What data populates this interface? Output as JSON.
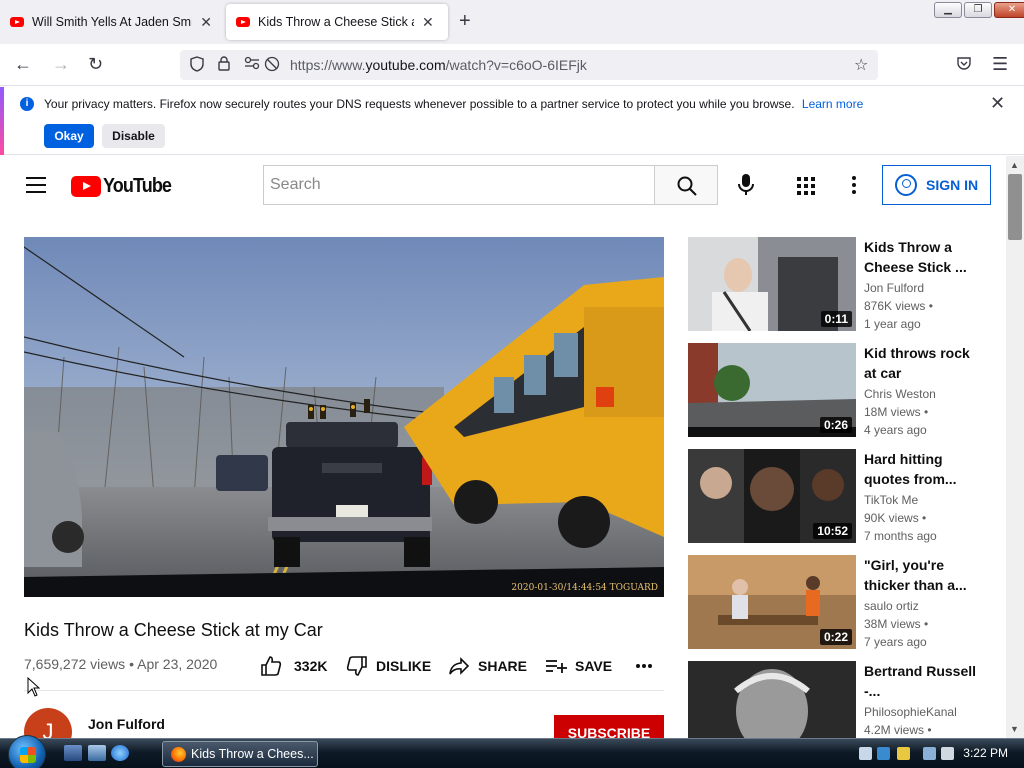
{
  "browser": {
    "tabs": [
      {
        "title": "Will Smith Yells At Jaden Smith",
        "active": false
      },
      {
        "title": "Kids Throw a Cheese Stick at my",
        "active": true
      }
    ],
    "url_prefix": "https://www.",
    "url_domain": "youtube.com",
    "url_path": "/watch?v=c6oO-6IEFjk"
  },
  "notification": {
    "message": "Your privacy matters. Firefox now securely routes your DNS requests whenever possible to a partner service to protect you while you browse.",
    "learn_more": "Learn more",
    "okay_label": "Okay",
    "disable_label": "Disable"
  },
  "youtube": {
    "logo_text": "YouTube",
    "search_placeholder": "Search",
    "sign_in_label": "SIGN IN"
  },
  "video": {
    "title": "Kids Throw a Cheese Stick at my Car",
    "views": "7,659,272 views",
    "date": "Apr 23, 2020",
    "meta_sep": "•",
    "likes": "332K",
    "dislike_label": "DISLIKE",
    "share_label": "SHARE",
    "save_label": "SAVE",
    "dashcam_timestamp": "2020-01-30/14:44:54 TOGUARD",
    "channel_name": "Jon Fulford",
    "channel_initial": "J",
    "subscribe_label": "SUBSCRIBE"
  },
  "recommendations": [
    {
      "title": "Kids Throw a Cheese Stick ...",
      "channel": "Jon Fulford",
      "views": "876K views •",
      "age": "1 year ago",
      "duration": "0:11"
    },
    {
      "title": "Kid throws rock at car",
      "channel": "Chris Weston",
      "views": "18M views •",
      "age": "4 years ago",
      "duration": "0:26"
    },
    {
      "title": "Hard hitting quotes from...",
      "channel": "TikTok Me",
      "views": "90K views •",
      "age": "7 months ago",
      "duration": "10:52"
    },
    {
      "title": "\"Girl, you're thicker than a...",
      "channel": "saulo ortiz",
      "views": "38M views •",
      "age": "7 years ago",
      "duration": "0:22"
    },
    {
      "title": "Bertrand Russell -...",
      "channel": "PhilosophieKanal",
      "views": "4.2M views •",
      "age": "",
      "duration": ""
    }
  ],
  "taskbar": {
    "active_window": "Kids Throw a Chees...",
    "clock": "3:22 PM"
  }
}
